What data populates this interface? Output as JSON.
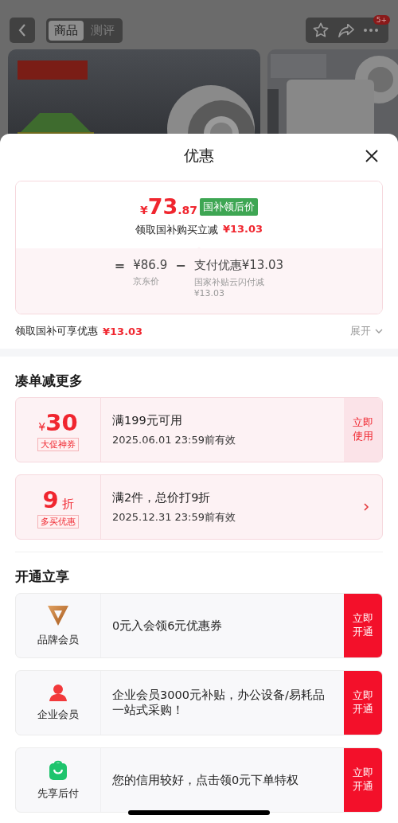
{
  "top_bar": {
    "tabs": [
      {
        "label": "商品",
        "selected": true
      },
      {
        "label": "测评",
        "selected": false
      }
    ],
    "badge": "5+"
  },
  "sheet": {
    "title": "优惠",
    "price": {
      "currency": "¥",
      "integer": "73",
      "decimal": ".87",
      "tag": "国补领后价",
      "subtitle": "领取国补购买立减",
      "subtitle_amount": "¥13.03"
    },
    "formula": {
      "equals": "=",
      "base": "¥86.9",
      "base_label": "京东价",
      "minus": "−",
      "discount": "支付优惠¥13.03",
      "discount_label": "国家补贴云闪付减¥13.03"
    },
    "summary": {
      "label": "领取国补可享优惠",
      "amount": "¥13.03",
      "toggle": "展开"
    },
    "coupon_section": {
      "title": "凑单减更多",
      "coupons": [
        {
          "kind": "amount",
          "currency": "¥",
          "value": "30",
          "tag": "大促神券",
          "condition": "满199元可用",
          "validity": "2025.06.01 23:59前有效",
          "action": "立即使用"
        },
        {
          "kind": "discount",
          "value": "9",
          "unit": "折",
          "tag": "多买优惠",
          "condition": "满2件，总价打9折",
          "validity": "2025.12.31 23:59前有效"
        }
      ]
    },
    "member_section": {
      "title": "开通立享",
      "items": [
        {
          "kind": "brand",
          "label": "品牌会员",
          "text": "0元入会领6元优惠券",
          "action": "立即开通"
        },
        {
          "kind": "enterprise",
          "label": "企业会员",
          "text": "企业会员3000元补贴，办公设备/易耗品一站式采购！",
          "action": "立即开通"
        },
        {
          "kind": "paylater",
          "label": "先享后付",
          "text": "您的信用较好，点击领0元下单特权",
          "action": "立即开通"
        }
      ]
    }
  }
}
